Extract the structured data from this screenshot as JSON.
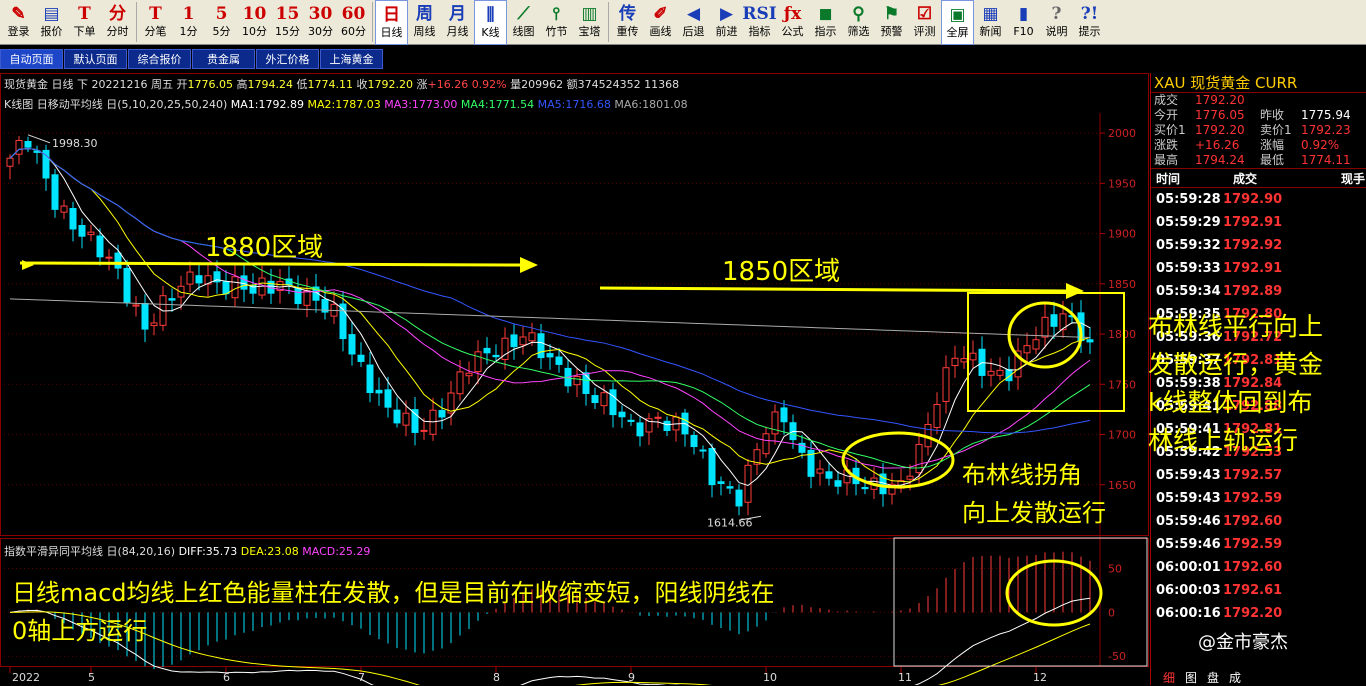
{
  "toolbar": [
    {
      "icon": "✎",
      "label": "登录",
      "color": ""
    },
    {
      "icon": "▤",
      "label": "报价",
      "color": "blue"
    },
    {
      "icon": "T",
      "label": "下单",
      "color": ""
    },
    {
      "icon": "分",
      "label": "分时",
      "color": ""
    },
    {
      "icon": "T",
      "label": "分笔",
      "color": ""
    },
    {
      "icon": "1",
      "label": "1分",
      "color": ""
    },
    {
      "icon": "5",
      "label": "5分",
      "color": ""
    },
    {
      "icon": "10",
      "label": "10分",
      "color": ""
    },
    {
      "icon": "15",
      "label": "15分",
      "color": ""
    },
    {
      "icon": "30",
      "label": "30分",
      "color": ""
    },
    {
      "icon": "60",
      "label": "60分",
      "color": ""
    },
    {
      "icon": "日",
      "label": "日线",
      "color": "",
      "active": true
    },
    {
      "icon": "周",
      "label": "周线",
      "color": "blue"
    },
    {
      "icon": "月",
      "label": "月线",
      "color": "blue"
    },
    {
      "icon": "⫼",
      "label": "K线",
      "color": "blue",
      "active": true
    },
    {
      "icon": "⟋",
      "label": "线图",
      "color": "green"
    },
    {
      "icon": "⫯",
      "label": "竹节",
      "color": "green"
    },
    {
      "icon": "▥",
      "label": "宝塔",
      "color": "green"
    },
    {
      "icon": "传",
      "label": "重传",
      "color": "blue"
    },
    {
      "icon": "✐",
      "label": "画线",
      "color": ""
    },
    {
      "icon": "◀",
      "label": "后退",
      "color": "blue"
    },
    {
      "icon": "▶",
      "label": "前进",
      "color": "blue"
    },
    {
      "icon": "RSI",
      "label": "指标",
      "color": "blue"
    },
    {
      "icon": "ƒx",
      "label": "公式",
      "color": ""
    },
    {
      "icon": "◼",
      "label": "指示",
      "color": "green"
    },
    {
      "icon": "⚲",
      "label": "筛选",
      "color": "green"
    },
    {
      "icon": "⚑",
      "label": "预警",
      "color": "green"
    },
    {
      "icon": "☑",
      "label": "评测",
      "color": ""
    },
    {
      "icon": "▣",
      "label": "全屏",
      "color": "green",
      "active": true
    },
    {
      "icon": "▦",
      "label": "新闻",
      "color": "blue"
    },
    {
      "icon": "▮",
      "label": "F10",
      "color": "blue"
    },
    {
      "icon": "?",
      "label": "说明",
      "color": "gray"
    },
    {
      "icon": "?!",
      "label": "提示",
      "color": "blue"
    }
  ],
  "tabs": [
    "自动页面",
    "默认页面",
    "综合报价",
    "贵金属",
    "外汇价格",
    "上海黄金"
  ],
  "info_line": {
    "prefix": "现货黄金 日线 下  20221216 周五 开",
    "open": "1776.05",
    "high_lbl": "高",
    "high": "1794.24",
    "low_lbl": "低",
    "low": "1774.11",
    "close_lbl": "收",
    "close": "1792.20",
    "chg_lbl": "涨",
    "chg": "+16.26 0.92%",
    "rest": "量209962 额374524352 11368"
  },
  "ma_line": {
    "prefix": "K线图 日移动平均线 日(5,10,20,25,50,240)",
    "ma1": "MA1:1792.89",
    "ma2": "MA2:1787.03",
    "ma3": "MA3:1773.00",
    "ma4": "MA4:1771.54",
    "ma5": "MA5:1716.68",
    "ma6": "MA6:1801.08"
  },
  "macd_line": {
    "prefix": "指数平滑异同平均线 日(84,20,16)",
    "diff": "DIFF:35.73",
    "dea": "DEA:23.08",
    "macd": "MACD:25.29"
  },
  "colors": {
    "up": "#ff3b3b",
    "down": "#00e5ff",
    "ma1": "#ffffff",
    "ma2": "#ffff00",
    "ma3": "#ff44ff",
    "ma4": "#33ff66",
    "ma5": "#3355ff",
    "ma6": "#aaaaaa",
    "annotation": "#ffff00"
  },
  "annotations": {
    "zone1880": "1880区域",
    "zone1850": "1850区域",
    "boll_turn_1": "布林线拐角",
    "boll_turn_2": "向上发散运行",
    "right_1": "布林线平行向上",
    "right_2": "发散运行，黄金",
    "right_3": "k线整体回到布",
    "right_4": "林线上轨运行",
    "macd_1": "日线macd均线上红色能量柱在发散，但是目前在收缩变短，阳线阴线在",
    "macd_2": "0轴上方运行"
  },
  "chart_data": {
    "type": "candlestick",
    "price_axis": [
      "2000",
      "1950",
      "1900",
      "1850",
      "1800",
      "1750",
      "1700",
      "1650"
    ],
    "ylim": [
      1600,
      2020
    ],
    "macd_axis": [
      "50",
      "0",
      "-50"
    ],
    "macd_ylim": [
      -60,
      70
    ],
    "x_ticks": [
      {
        "label": "2022",
        "index": 0
      },
      {
        "label": "5",
        "index": 9
      },
      {
        "label": "6",
        "index": 24
      },
      {
        "label": "7",
        "index": 39
      },
      {
        "label": "8",
        "index": 54
      },
      {
        "label": "9",
        "index": 69
      },
      {
        "label": "10",
        "index": 84
      },
      {
        "label": "11",
        "index": 99
      },
      {
        "label": "12",
        "index": 114
      }
    ],
    "marked_high": {
      "label": "1998.30",
      "value": 1998.3,
      "index": 2
    },
    "marked_low": {
      "label": "1614.66",
      "value": 1614.66,
      "index": 81
    },
    "anchors": [
      [
        0,
        1975
      ],
      [
        2,
        1990
      ],
      [
        5,
        1935
      ],
      [
        9,
        1890
      ],
      [
        12,
        1860
      ],
      [
        15,
        1810
      ],
      [
        18,
        1835
      ],
      [
        21,
        1862
      ],
      [
        24,
        1850
      ],
      [
        27,
        1840
      ],
      [
        30,
        1855
      ],
      [
        33,
        1835
      ],
      [
        36,
        1818
      ],
      [
        39,
        1770
      ],
      [
        42,
        1720
      ],
      [
        45,
        1705
      ],
      [
        48,
        1728
      ],
      [
        51,
        1765
      ],
      [
        54,
        1788
      ],
      [
        57,
        1800
      ],
      [
        60,
        1770
      ],
      [
        63,
        1755
      ],
      [
        66,
        1730
      ],
      [
        69,
        1705
      ],
      [
        72,
        1720
      ],
      [
        75,
        1700
      ],
      [
        78,
        1660
      ],
      [
        81,
        1640
      ],
      [
        84,
        1702
      ],
      [
        86,
        1720
      ],
      [
        88,
        1680
      ],
      [
        91,
        1650
      ],
      [
        94,
        1655
      ],
      [
        97,
        1652
      ],
      [
        99,
        1645
      ],
      [
        101,
        1680
      ],
      [
        103,
        1740
      ],
      [
        105,
        1785
      ],
      [
        107,
        1770
      ],
      [
        109,
        1755
      ],
      [
        111,
        1765
      ],
      [
        113,
        1795
      ],
      [
        115,
        1805
      ],
      [
        117,
        1815
      ],
      [
        119,
        1805
      ],
      [
        120,
        1792
      ]
    ]
  },
  "panel": {
    "symbol": "XAU  现货黄金   CURR",
    "quote": [
      {
        "l1": "成交",
        "v1": "1792.20",
        "c1": "red",
        "l2": "",
        "v2": "",
        "c2": ""
      },
      {
        "l1": "今开",
        "v1": "1776.05",
        "c1": "red",
        "l2": "昨收",
        "v2": "1775.94",
        "c2": "white"
      },
      {
        "l1": "买价1",
        "v1": "1792.20",
        "c1": "red",
        "l2": "卖价1",
        "v2": "1792.23",
        "c2": "red"
      },
      {
        "l1": "涨跌",
        "v1": "+16.26",
        "c1": "red",
        "l2": "涨幅",
        "v2": "0.92%",
        "c2": "red"
      },
      {
        "l1": "最高",
        "v1": "1794.24",
        "c1": "red",
        "l2": "最低",
        "v2": "1774.11",
        "c2": "red"
      }
    ],
    "tick_head": {
      "time": "时间",
      "price": "成交",
      "extra": "现手"
    },
    "ticks": [
      {
        "time": "05:59:28",
        "price": "1792.90"
      },
      {
        "time": "05:59:29",
        "price": "1792.91"
      },
      {
        "time": "05:59:32",
        "price": "1792.92"
      },
      {
        "time": "05:59:33",
        "price": "1792.91"
      },
      {
        "time": "05:59:34",
        "price": "1792.89"
      },
      {
        "time": "05:59:35",
        "price": "1792.80"
      },
      {
        "time": "05:59:36",
        "price": "1792.72"
      },
      {
        "time": "05:59:37",
        "price": "1792.81"
      },
      {
        "time": "05:59:38",
        "price": "1792.84"
      },
      {
        "time": "05:59:41",
        "price": "1792.88"
      },
      {
        "time": "05:59:41",
        "price": "1792.81"
      },
      {
        "time": "05:59:42",
        "price": "1792.53"
      },
      {
        "time": "05:59:43",
        "price": "1792.57"
      },
      {
        "time": "05:59:43",
        "price": "1792.59"
      },
      {
        "time": "05:59:46",
        "price": "1792.60"
      },
      {
        "time": "05:59:46",
        "price": "1792.59"
      },
      {
        "time": "06:00:01",
        "price": "1792.60"
      },
      {
        "time": "06:00:03",
        "price": "1792.61"
      },
      {
        "time": "06:00:16",
        "price": "1792.20"
      }
    ],
    "foot": [
      "细",
      "图",
      "盘",
      "成"
    ]
  },
  "watermark": "@金市豪杰"
}
